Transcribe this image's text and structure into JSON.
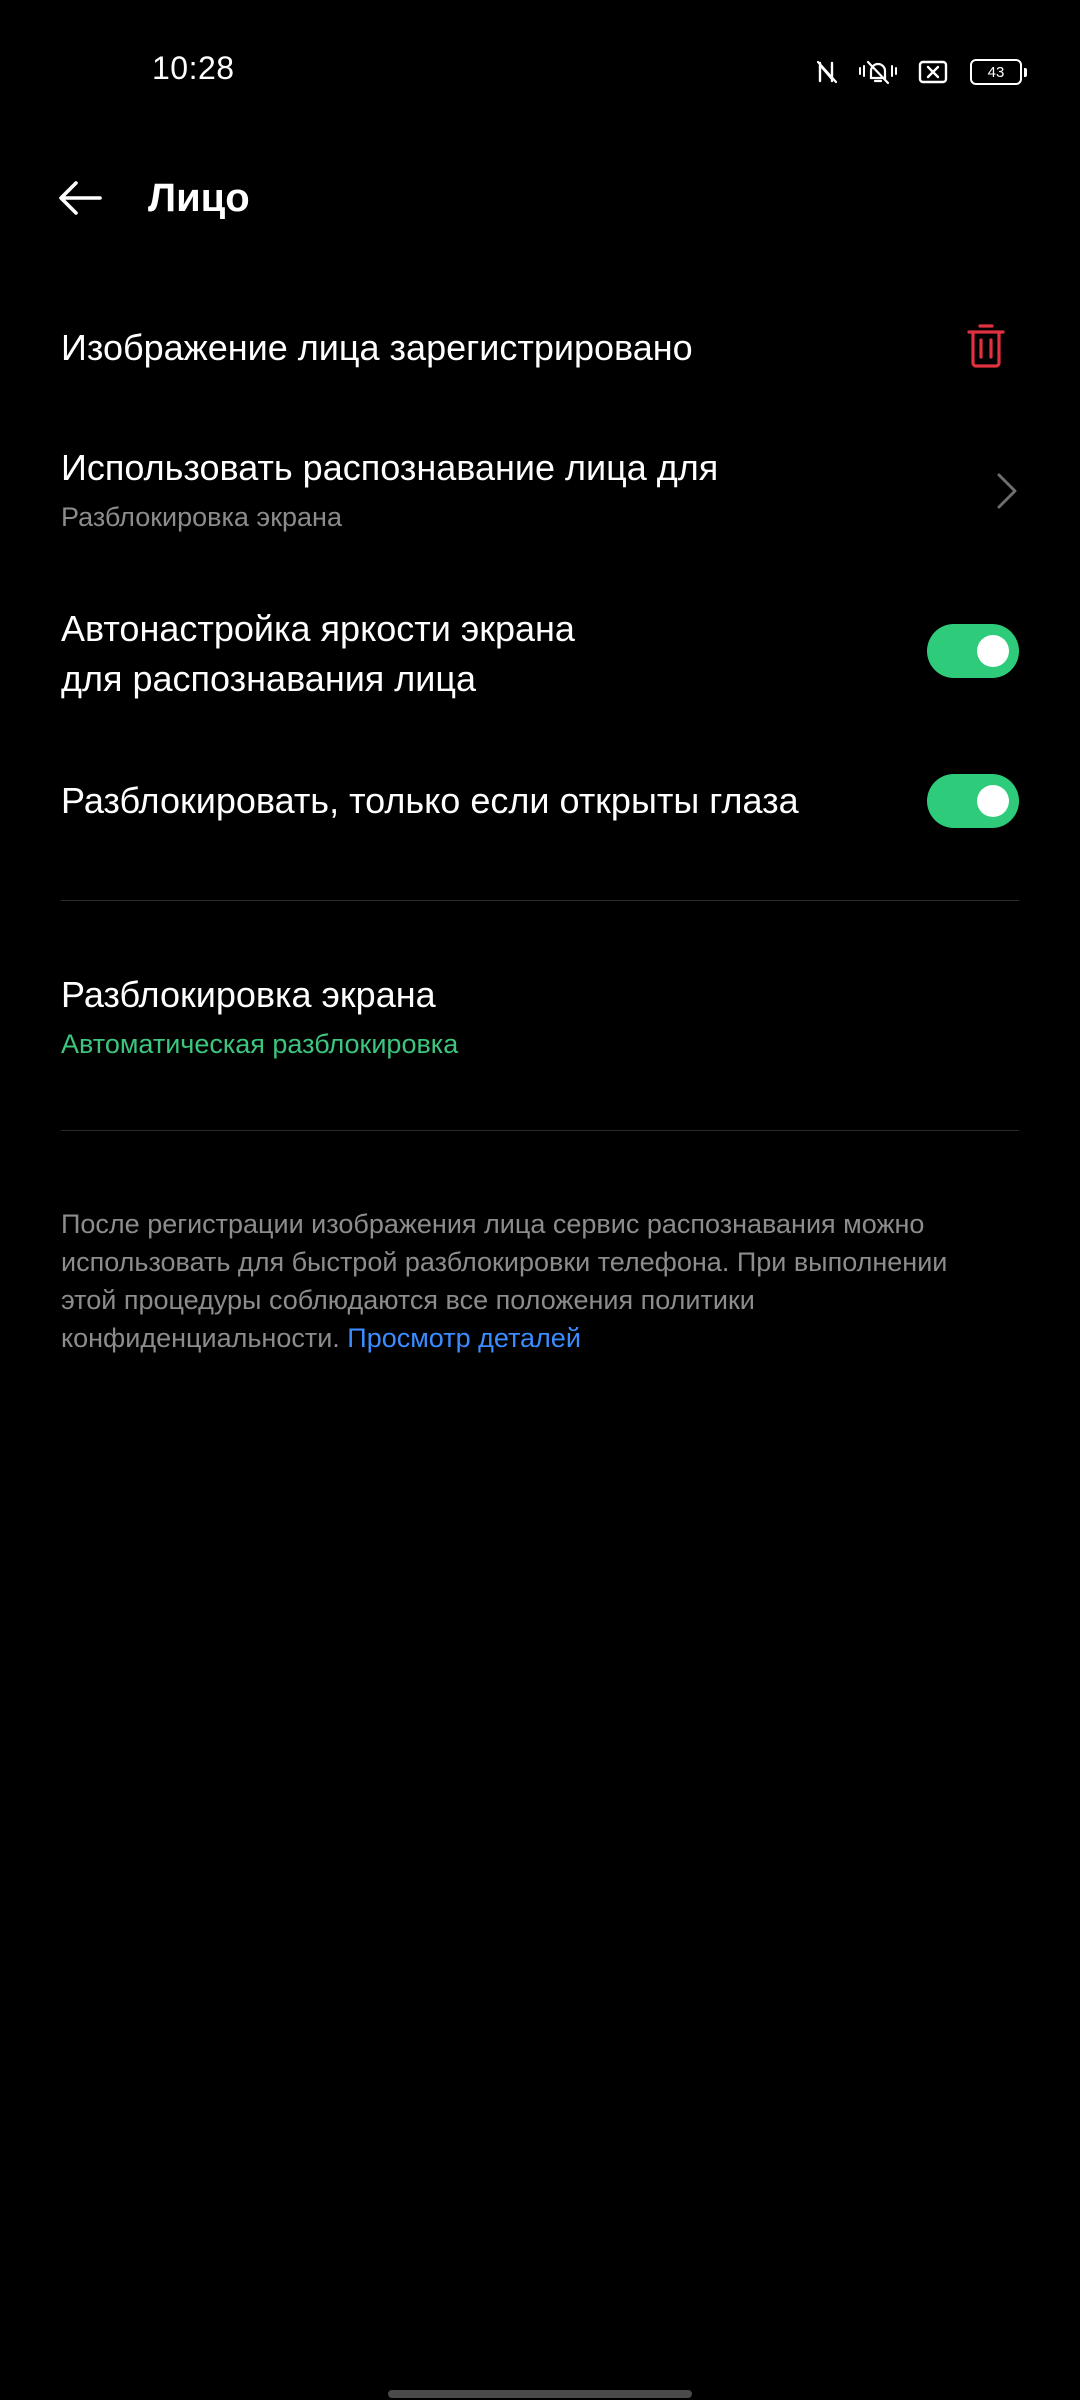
{
  "status_bar": {
    "time": "10:28",
    "battery": "43",
    "icons": [
      "nfc-icon",
      "vibrate-icon",
      "sim-off-icon",
      "battery-icon"
    ]
  },
  "header": {
    "back_icon": "arrow-left-icon",
    "title": "Лицо"
  },
  "settings": {
    "face_registered": {
      "label": "Изображение лица зарегистрировано",
      "icon": "trash-icon",
      "icon_color": "#e0313f"
    },
    "use_face_for": {
      "label": "Использовать распознавание лица для",
      "value": "Разблокировка экрана"
    },
    "auto_brightness": {
      "label_line1": "Автонастройка яркости экрана",
      "label_line2": "для распознавания лица",
      "enabled": true
    },
    "eyes_open": {
      "label": "Разблокировать, только если открыты глаза",
      "enabled": true
    },
    "screen_unlock": {
      "label": "Разблокировка экрана",
      "value": "Автоматическая разблокировка",
      "value_color": "#3bc57e"
    }
  },
  "footer": {
    "text": "После регистрации изображения лица сервис распознавания можно использовать для быстрой разблокировки телефона. При выполнении этой процедуры соблюдаются все положения политики конфиденциальности.",
    "link": "Просмотр деталей"
  },
  "colors": {
    "background": "#000000",
    "toggle_on": "#2ecc7a",
    "link": "#3a8cff",
    "secondary_text": "#8c8c8c"
  }
}
